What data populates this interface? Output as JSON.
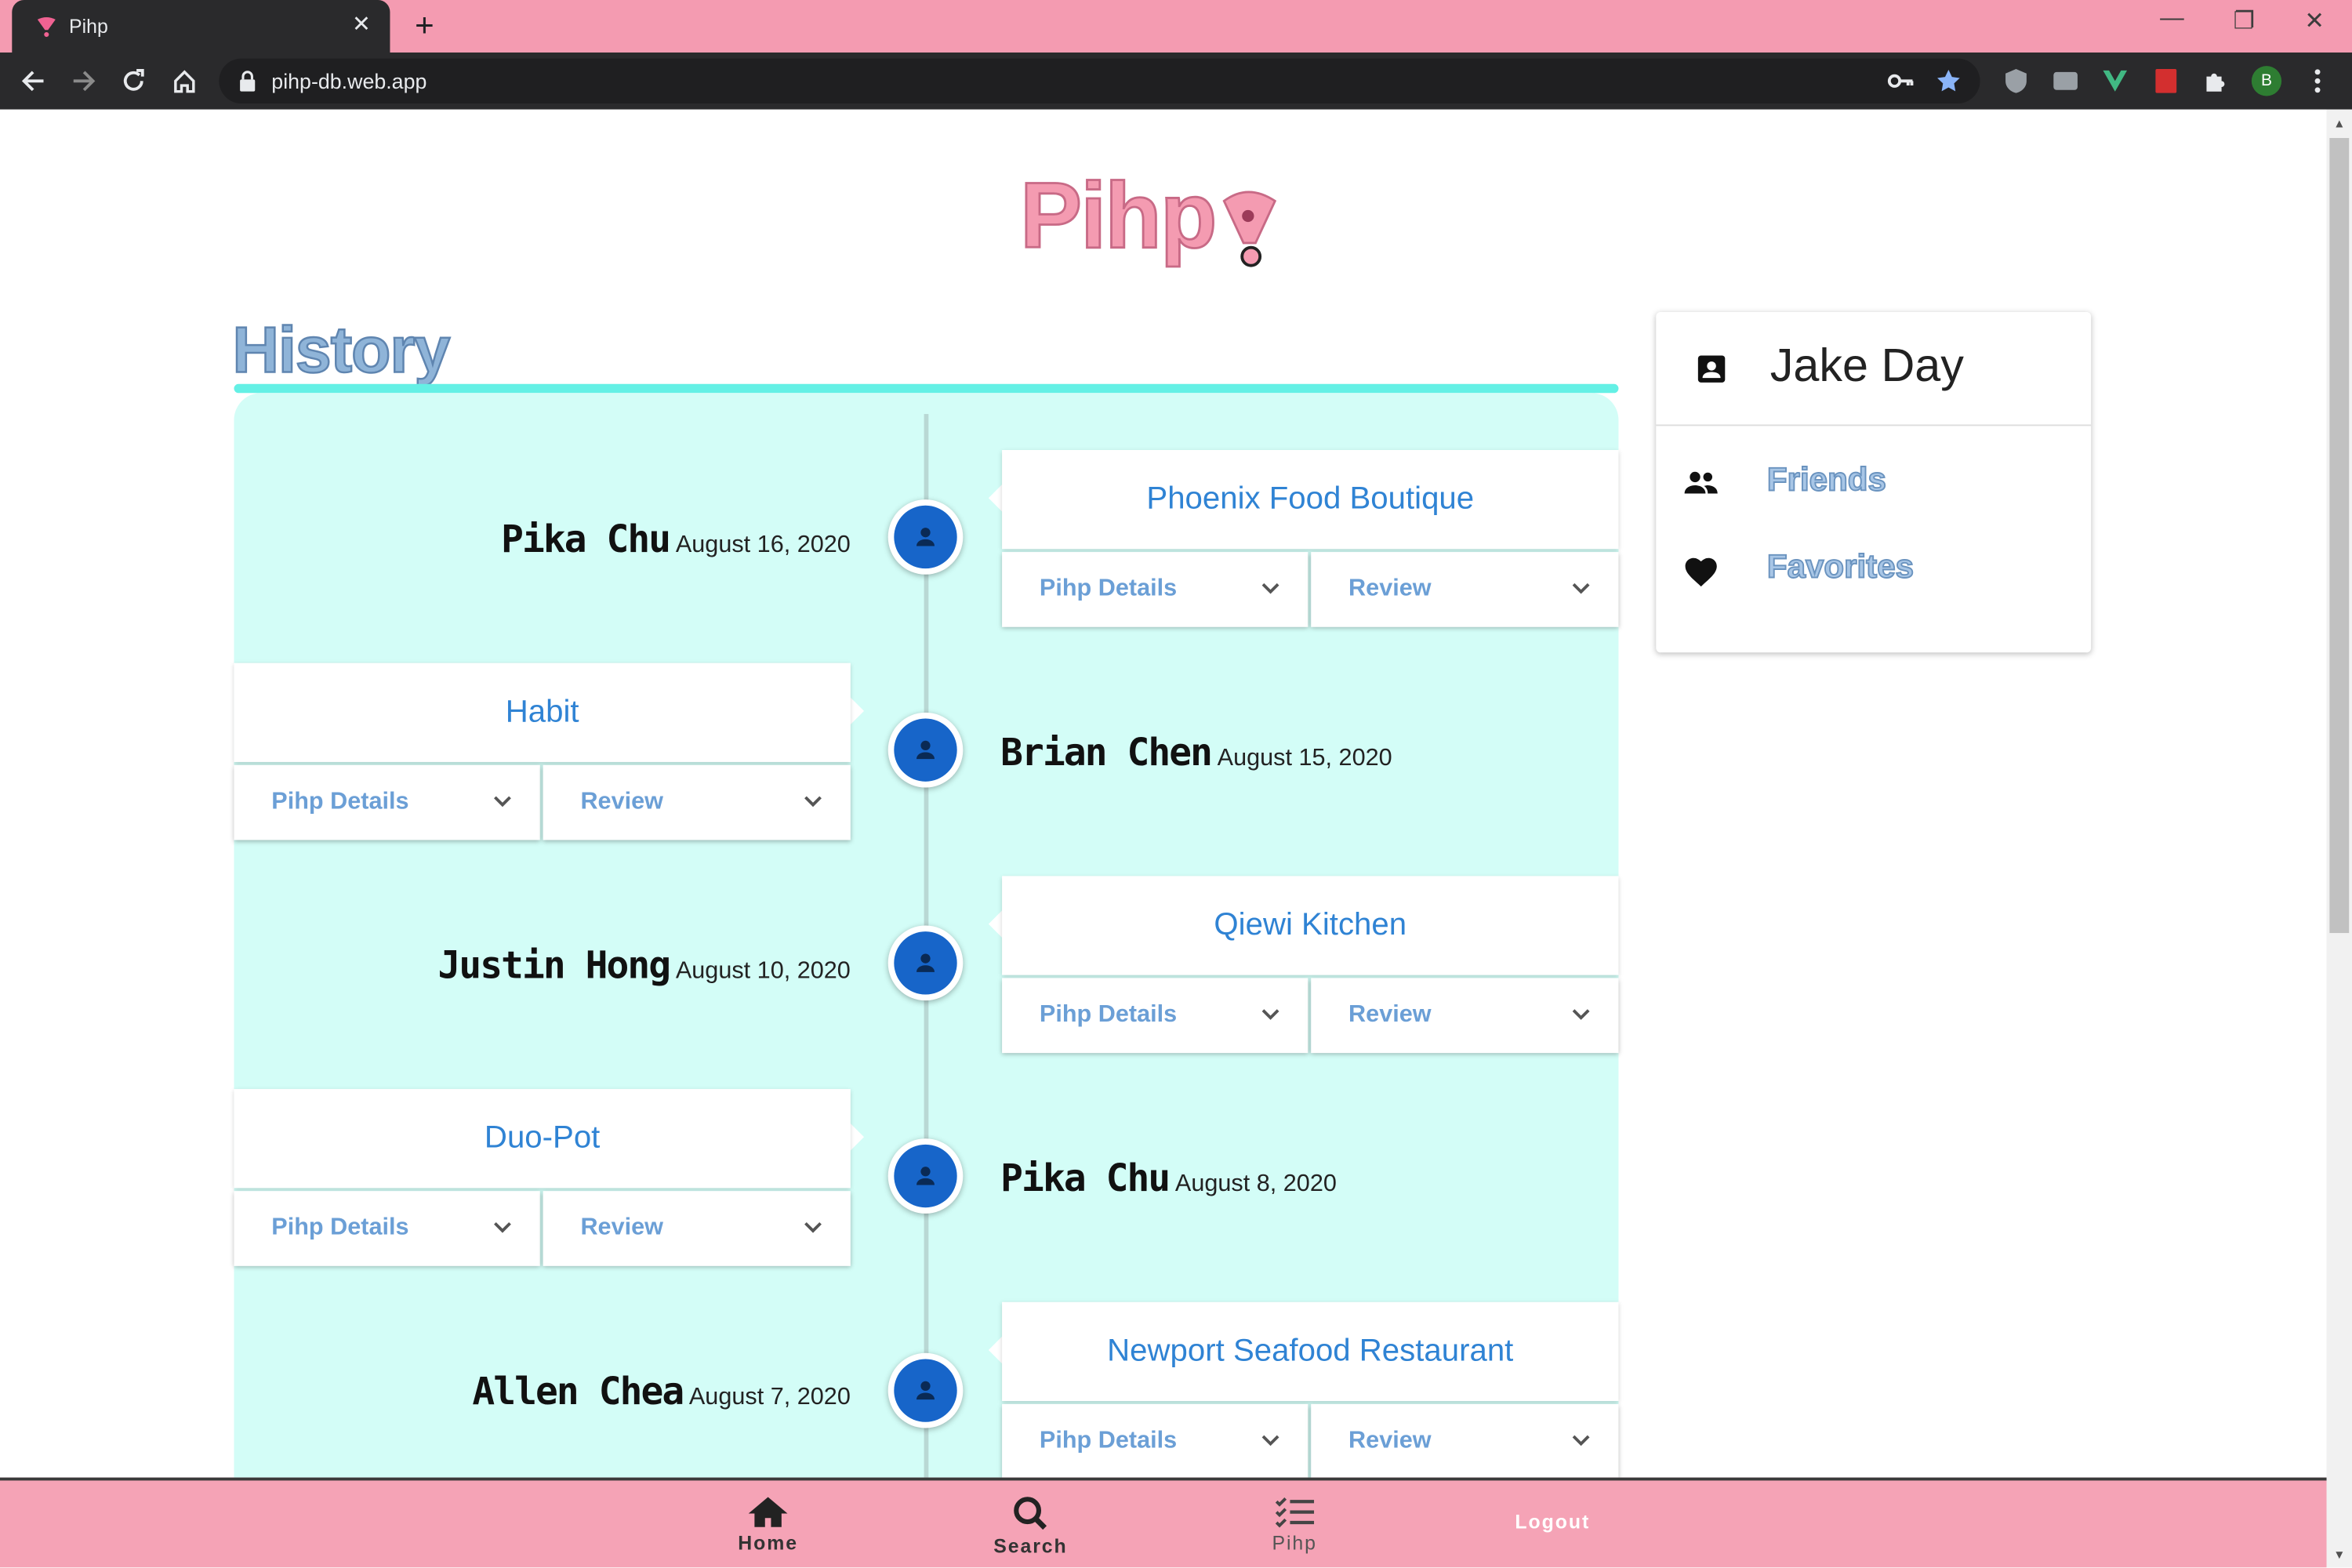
{
  "browser": {
    "tab_title": "Pihp",
    "url": "pihp-db.web.app",
    "profile_initial": "B"
  },
  "logo": {
    "text": "Pihp"
  },
  "history": {
    "title": "History",
    "entries": [
      {
        "side": "right",
        "person": "Pika Chu",
        "date": "August 16, 2020",
        "restaurant": "Phoenix Food Boutique",
        "details_label": "Pihp Details",
        "review_label": "Review"
      },
      {
        "side": "left",
        "person": "Brian Chen",
        "date": "August 15, 2020",
        "restaurant": "Habit",
        "details_label": "Pihp Details",
        "review_label": "Review"
      },
      {
        "side": "right",
        "person": "Justin Hong",
        "date": "August 10, 2020",
        "restaurant": "Qiewi Kitchen",
        "details_label": "Pihp Details",
        "review_label": "Review"
      },
      {
        "side": "left",
        "person": "Pika Chu",
        "date": "August 8, 2020",
        "restaurant": "Duo-Pot",
        "details_label": "Pihp Details",
        "review_label": "Review"
      },
      {
        "side": "right",
        "person": "Allen Chea",
        "date": "August 7, 2020",
        "restaurant": "Newport Seafood Restaurant",
        "details_label": "Pihp Details",
        "review_label": "Review"
      }
    ]
  },
  "sidebar": {
    "user_name": "Jake Day",
    "links": [
      {
        "label": "Friends",
        "icon": "people-icon"
      },
      {
        "label": "Favorites",
        "icon": "heart-icon"
      }
    ]
  },
  "bottom_nav": {
    "home": "Home",
    "search": "Search",
    "pihp": "Pihp",
    "logout": "Logout"
  },
  "colors": {
    "brand_pink": "#f49bb1",
    "timeline_bg": "#d3fdf7",
    "accent_teal": "#64f0e5",
    "node_blue": "#1765c9",
    "link_blue": "#2f83d4"
  }
}
